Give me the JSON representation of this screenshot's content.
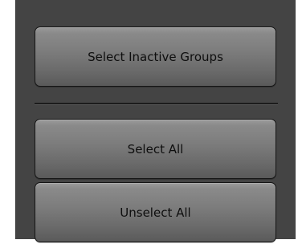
{
  "buttons": {
    "select_inactive_groups": "Select Inactive Groups",
    "select_all": "Select All",
    "unselect_all": "Unselect All"
  },
  "colors": {
    "panel_background": "#444444",
    "button_text": "#0e0e0e",
    "divider": "#1c1c1c"
  }
}
